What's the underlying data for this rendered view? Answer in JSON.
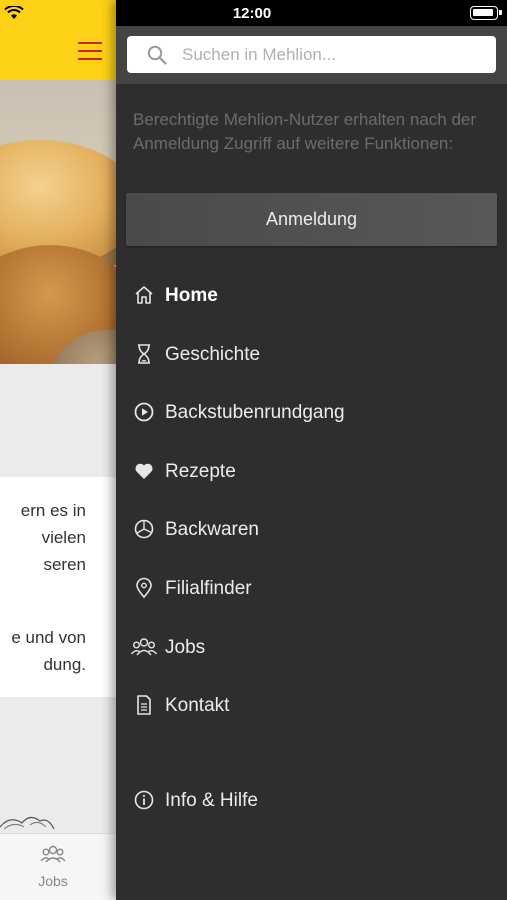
{
  "status_bar": {
    "time": "12:00"
  },
  "background_app": {
    "paragraph_1": [
      "ern es in",
      "vielen",
      "seren"
    ],
    "paragraph_2": [
      "e und von",
      "dung."
    ],
    "tab_jobs_label": "Jobs"
  },
  "drawer": {
    "search": {
      "placeholder": "Suchen in Mehlion..."
    },
    "notice": "Berechtigte Mehlion-Nutzer erhalten nach der Anmeldung Zugriff auf weitere Funktionen:",
    "login_button": "Anmeldung",
    "menu": [
      {
        "label": "Home",
        "icon": "home-icon",
        "active": true
      },
      {
        "label": "Geschichte",
        "icon": "hourglass-icon"
      },
      {
        "label": "Backstubenrundgang",
        "icon": "play-circle-icon"
      },
      {
        "label": "Rezepte",
        "icon": "heart-icon"
      },
      {
        "label": "Backwaren",
        "icon": "pie-chart-icon"
      },
      {
        "label": "Filialfinder",
        "icon": "map-pin-icon"
      },
      {
        "label": "Jobs",
        "icon": "people-icon"
      },
      {
        "label": "Kontakt",
        "icon": "document-icon"
      },
      {
        "label": "Info & Hilfe",
        "icon": "info-icon"
      }
    ]
  },
  "colors": {
    "brand_yellow": "#fcd116",
    "brand_red": "#c8262b",
    "drawer_bg": "#2e2e2e"
  }
}
